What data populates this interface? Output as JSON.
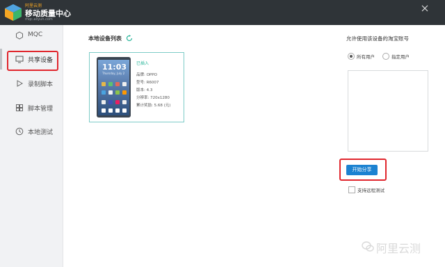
{
  "app": {
    "brand_top": "阿里云测",
    "title": "移动质量中心",
    "subtitle": "mqc.aliyun.com"
  },
  "sidebar": {
    "items": [
      {
        "label": "MQC",
        "icon": "hexagon-icon"
      },
      {
        "label": "共享设备",
        "icon": "monitor-icon"
      },
      {
        "label": "录制脚本",
        "icon": "play-icon"
      },
      {
        "label": "脚本管理",
        "icon": "grid-icon"
      },
      {
        "label": "本地测试",
        "icon": "clock-icon"
      }
    ],
    "active_index": 1
  },
  "main": {
    "section_title": "本地设备列表",
    "device": {
      "status": "已插入",
      "brand": "品牌: OPPO",
      "model": "型号: R6007",
      "version": "版本: 4.3",
      "resolution": "分辨率: 720x1280",
      "earnings": "累计奖励: 5.68 (元)",
      "phone_time": "11:03",
      "phone_date": "Thursday, July 2"
    }
  },
  "right": {
    "title": "允许使用该设备的淘宝账号",
    "radio_all": "所有用户",
    "radio_specific": "指定用户",
    "selected": "all",
    "share_button": "开始分享",
    "remote_test_label": "支持远程测试"
  },
  "watermark": "阿里云测",
  "colors": {
    "titlebar": "#2f3438",
    "accent": "#1b82d1",
    "highlight": "#e0252c",
    "status": "#29b59a"
  }
}
